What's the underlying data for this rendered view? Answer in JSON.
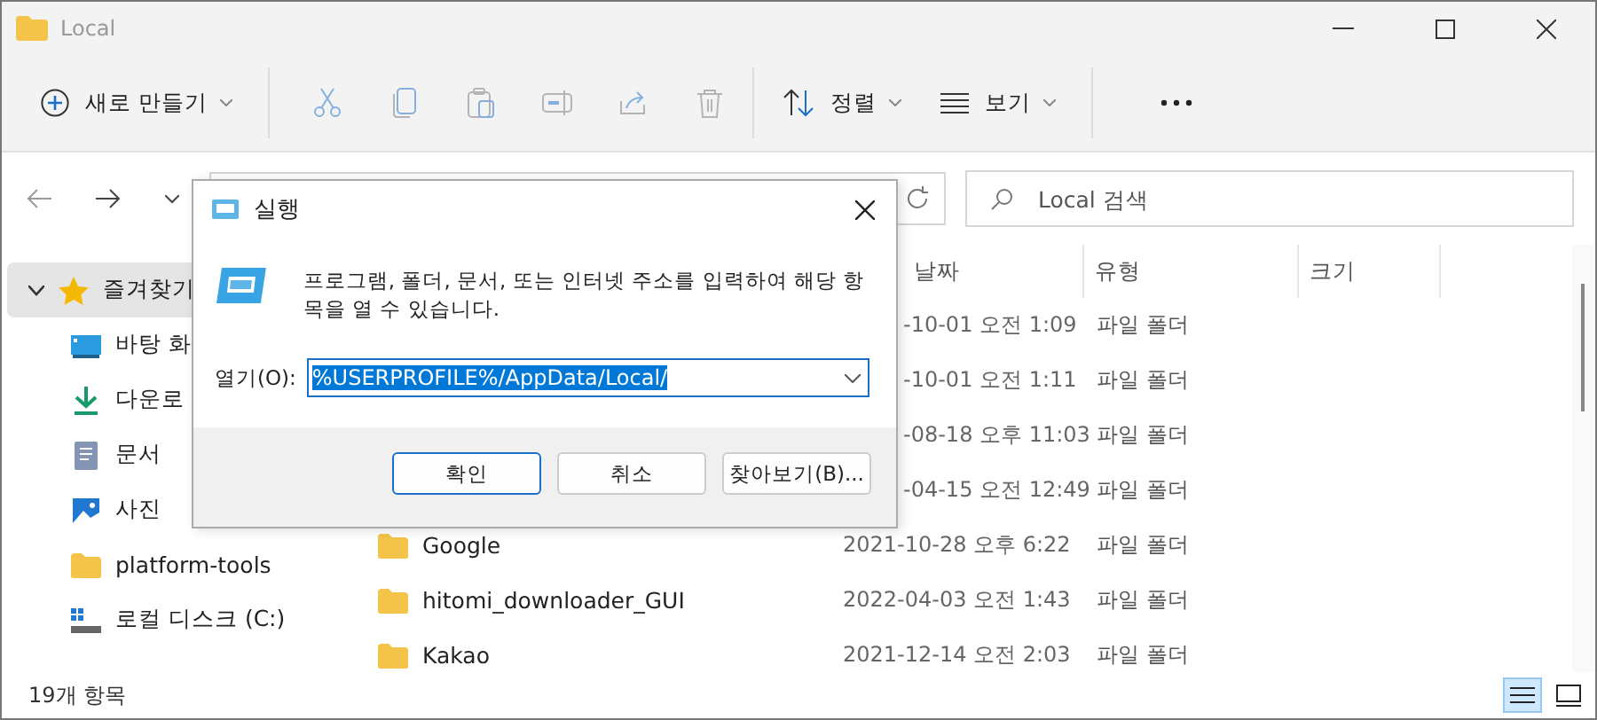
{
  "window": {
    "title": "Local"
  },
  "toolbar": {
    "new_button": {
      "label": "새로 만들기"
    },
    "actions": [
      {
        "kind": "cut",
        "disabled": true
      },
      {
        "kind": "copy",
        "disabled": true
      },
      {
        "kind": "paste",
        "disabled": true
      },
      {
        "kind": "rename",
        "disabled": true
      },
      {
        "kind": "share",
        "disabled": true
      },
      {
        "kind": "delete",
        "disabled": true
      }
    ],
    "sort_button": {
      "label": "정렬"
    },
    "view_button": {
      "label": "보기"
    }
  },
  "search": {
    "placeholder": "Local 검색"
  },
  "sidebar": {
    "items": [
      {
        "label": "즐겨찾기",
        "kind": "star",
        "expanded": true,
        "selected": true,
        "children": [
          {
            "label": "바탕 화",
            "kind": "desktop",
            "selected": false
          },
          {
            "label": "다운로",
            "kind": "download",
            "selected": false
          },
          {
            "label": "문서",
            "kind": "document",
            "selected": false
          },
          {
            "label": "사진",
            "kind": "picture",
            "selected": false
          },
          {
            "label": "platform-tools",
            "kind": "folder",
            "selected": false
          },
          {
            "label": "로컬 디스크 (C:)",
            "kind": "drive",
            "selected": false
          }
        ]
      }
    ]
  },
  "table": {
    "columns": [
      "날짜",
      "유형",
      "크기"
    ],
    "rows": [
      {
        "date": "-10-01 오전 1:09",
        "type": "파일 폴더"
      },
      {
        "date": "-10-01 오전 1:11",
        "type": "파일 폴더"
      },
      {
        "date": "-08-18 오후 11:03",
        "type": "파일 폴더"
      },
      {
        "date": "-04-15 오전 12:49",
        "type": "파일 폴더"
      },
      {
        "name": "Google",
        "date": "2021-10-28 오후 6:22",
        "type": "파일 폴더"
      },
      {
        "name": "hitomi_downloader_GUI",
        "date": "2022-04-03 오전 1:43",
        "type": "파일 폴더"
      },
      {
        "name": "Kakao",
        "date": "2021-12-14 오전 2:03",
        "type": "파일 폴더"
      }
    ]
  },
  "status_bar": {
    "count": "19개 항목",
    "views": [
      {
        "kind": "details",
        "selected": true
      },
      {
        "kind": "tiles",
        "selected": false
      }
    ]
  },
  "run_dialog": {
    "title": "실행",
    "description": "프로그램, 폴더, 문서, 또는 인터넷 주소를 입력하여 해당 항목을 열 수 있습니다.",
    "open_label": "열기(O):",
    "value": "%USERPROFILE%/AppData/Local/",
    "buttons": [
      {
        "label": "확인",
        "selected": true
      },
      {
        "label": "취소",
        "selected": false
      },
      {
        "label": "찾아보기(B)...",
        "selected": false
      }
    ]
  }
}
